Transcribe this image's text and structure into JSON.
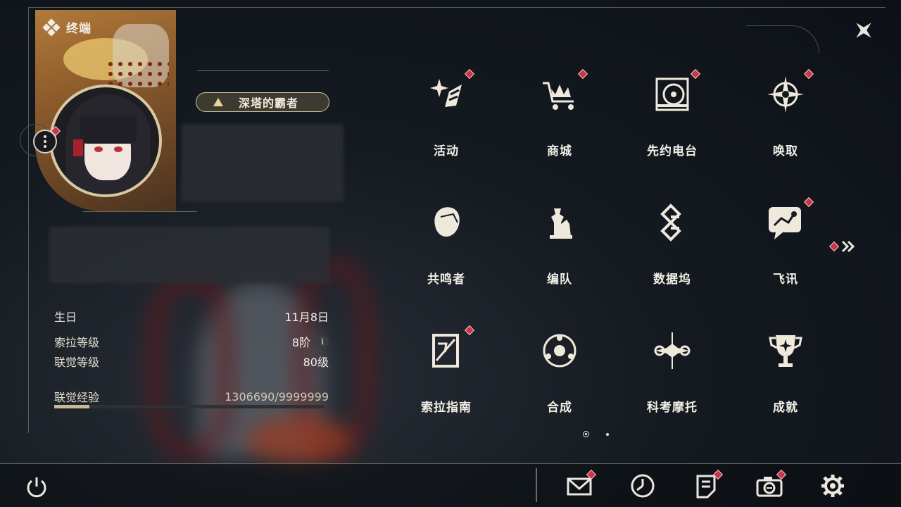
{
  "header": {
    "title": "终端",
    "logo_icon": "diamond-cluster-icon",
    "close_icon": "close-star-icon"
  },
  "profile": {
    "title_badge": "深塔的霸者",
    "avatar": "character-avatar",
    "stats": [
      {
        "label": "生日",
        "value": "11月8日"
      },
      {
        "label": "索拉等级",
        "value": "8阶",
        "has_info": true
      },
      {
        "label": "联觉等级",
        "value": "80级"
      }
    ],
    "exp": {
      "label": "联觉经验",
      "value": "1306690/9999999",
      "progress": 0.13
    }
  },
  "menu": {
    "items": [
      {
        "label": "活动",
        "icon": "sparkle-activity-icon",
        "notify": true
      },
      {
        "label": "商城",
        "icon": "crown-cart-icon",
        "notify": true
      },
      {
        "label": "先约电台",
        "icon": "radio-disc-icon",
        "notify": true
      },
      {
        "label": "唤取",
        "icon": "compass-star-icon",
        "notify": true
      },
      {
        "label": "共鸣者",
        "icon": "character-head-icon",
        "notify": false
      },
      {
        "label": "编队",
        "icon": "chess-team-icon",
        "notify": false
      },
      {
        "label": "数据坞",
        "icon": "data-dock-icon",
        "notify": false
      },
      {
        "label": "飞讯",
        "icon": "chat-message-icon",
        "notify": true
      },
      {
        "label": "索拉指南",
        "icon": "guide-book-icon",
        "notify": true
      },
      {
        "label": "合成",
        "icon": "synthesis-icon",
        "notify": false
      },
      {
        "label": "科考摩托",
        "icon": "motorbike-icon",
        "notify": false
      },
      {
        "label": "成就",
        "icon": "trophy-icon",
        "notify": false
      }
    ],
    "pagination": {
      "current": 1,
      "total": 2
    },
    "next_icon": "double-chevron-right-icon"
  },
  "bottom_bar": {
    "power_icon": "power-icon",
    "items": [
      {
        "icon": "mail-icon",
        "notify": true
      },
      {
        "icon": "clock-icon",
        "notify": false
      },
      {
        "icon": "notice-icon",
        "notify": true
      },
      {
        "icon": "camera-icon",
        "notify": true
      },
      {
        "icon": "settings-gear-icon",
        "notify": false
      }
    ]
  },
  "colors": {
    "accent": "#cdbf98",
    "notify": "#c93545",
    "text": "#f3efe6",
    "background": "#151a21"
  }
}
